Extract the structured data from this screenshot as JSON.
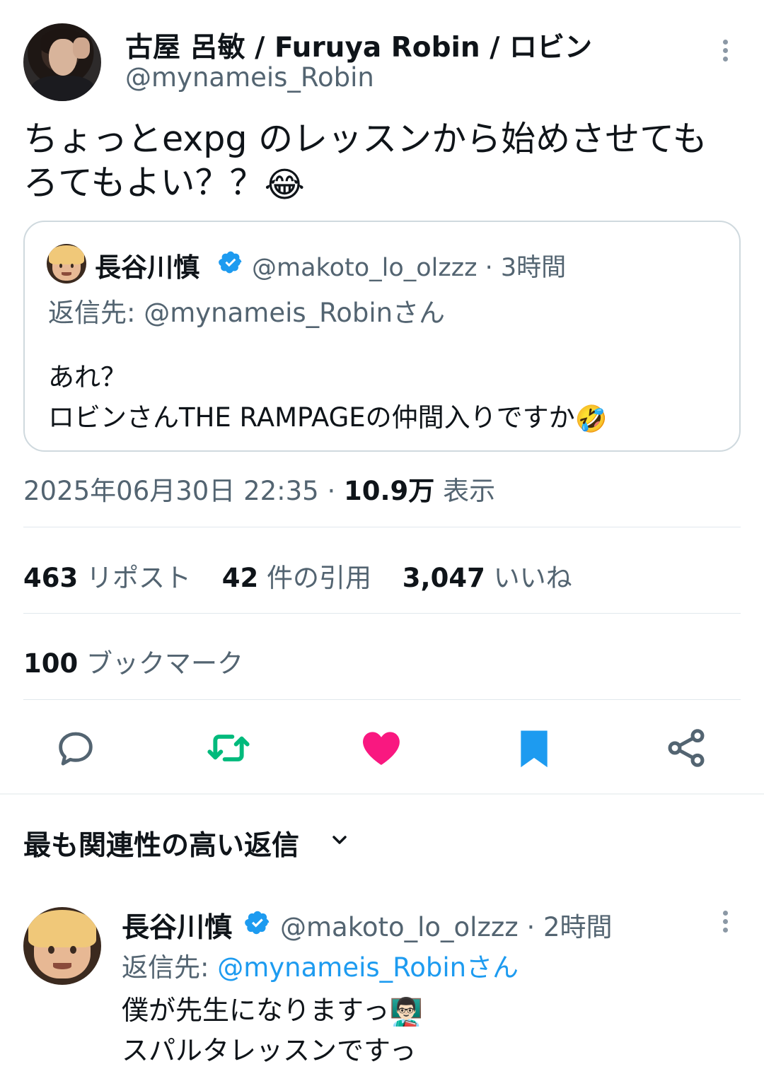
{
  "tweet": {
    "author_name": "古屋 呂敏 / Furuya Robin / ロビン",
    "author_handle": "@mynameis_Robin",
    "text": "ちょっとexpg のレッスンから始めさせてもろてもよい？？",
    "text_emoji": "😂",
    "timestamp": "2025年06月30日 22:35",
    "views_count": "10.9万",
    "views_label": "表示",
    "stats": {
      "reposts_count": "463",
      "reposts_label": "リポスト",
      "quotes_count": "42",
      "quotes_label": "件の引用",
      "likes_count": "3,047",
      "likes_label": "いいね",
      "bookmarks_count": "100",
      "bookmarks_label": "ブックマーク"
    }
  },
  "quoted": {
    "author_name": "長谷川慎",
    "author_handle": "@makoto_lo_olzzz",
    "time": "3時間",
    "reply_to": "返信先: @mynameis_Robinさん",
    "line1": "あれ？",
    "line2": "ロビンさんTHE RAMPAGEの仲間入りですか",
    "line2_emoji": "🤣"
  },
  "actions": {
    "icons": [
      "reply-icon",
      "repost-icon",
      "like-icon",
      "bookmark-icon",
      "share-icon"
    ],
    "repost_color": "#00ba7c",
    "like_color": "#f91880",
    "bookmark_color": "#1d9bf0"
  },
  "replies_section": {
    "title": "最も関連性の高い返信"
  },
  "reply": {
    "author_name": "長谷川慎",
    "author_handle": "@makoto_lo_olzzz",
    "time": "2時間",
    "reply_prefix": "返信先: ",
    "reply_to": "@mynameis_Robinさん",
    "line1": "僕が先生になりますっ",
    "line1_emoji": "👨🏻‍🏫",
    "line2": "スパルタレッスンですっ"
  }
}
